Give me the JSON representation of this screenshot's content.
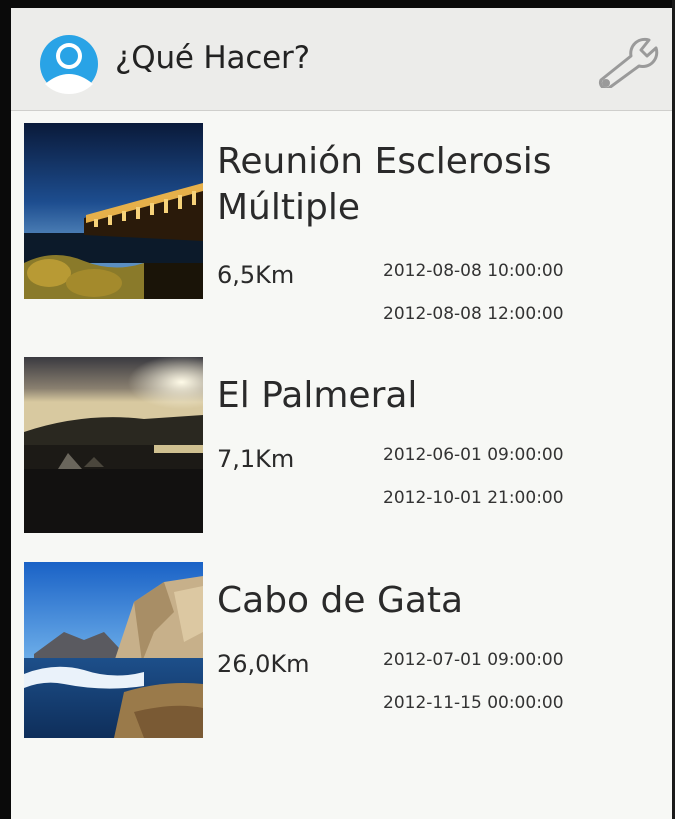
{
  "action_bar": {
    "title": "¿Qué Hacer?",
    "app_icon": "user-avatar-icon",
    "settings_icon": "wrench-icon"
  },
  "events": [
    {
      "title": "Reunión Esclerosis Múltiple",
      "distance": "6,5Km",
      "start": "2012-08-08 10:00:00",
      "end": "2012-08-08 12:00:00",
      "thumbnail": "pier-at-night-photo"
    },
    {
      "title": "El Palmeral",
      "distance": "7,1Km",
      "start": "2012-06-01 09:00:00",
      "end": "2012-10-01 21:00:00",
      "thumbnail": "beach-sunset-photo"
    },
    {
      "title": "Cabo de Gata",
      "distance": "26,0Km",
      "start": "2012-07-01 09:00:00",
      "end": "2012-11-15 00:00:00",
      "thumbnail": "coastal-cliffs-photo"
    }
  ],
  "colors": {
    "action_bar_bg": "#ececea",
    "list_bg": "#f7f8f5",
    "avatar_blue": "#29a3e6"
  }
}
